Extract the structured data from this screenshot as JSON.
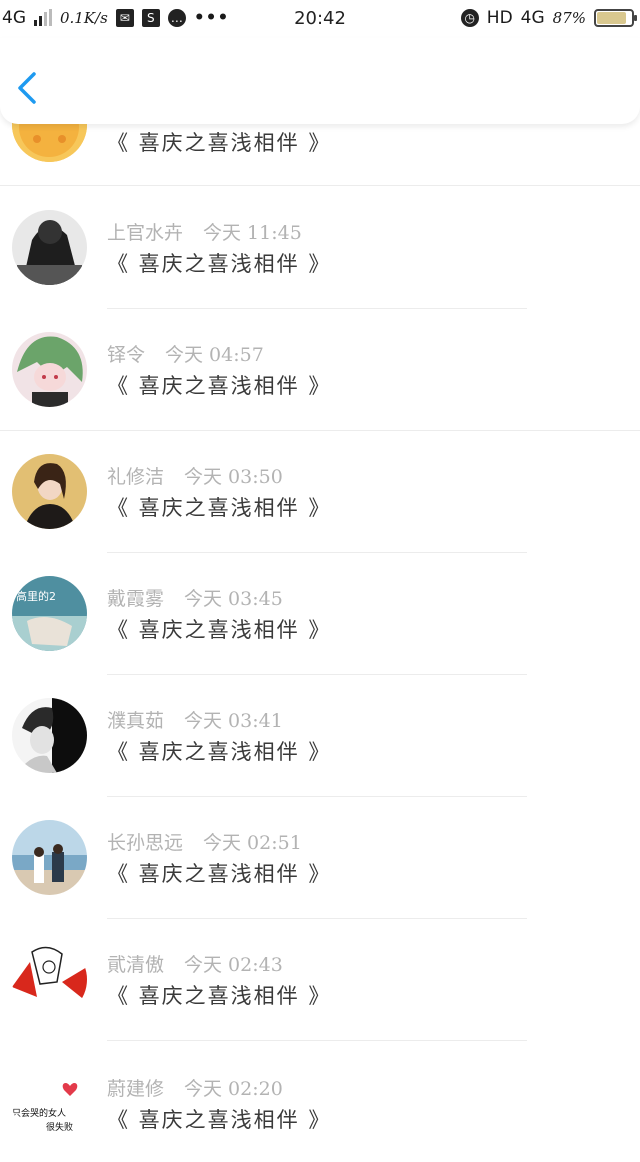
{
  "status_bar": {
    "network": "4G",
    "speed": "0.1K/s",
    "time": "20:42",
    "hd": "HD",
    "network_right": "4G",
    "battery": "87%",
    "battery_level": 0.87
  },
  "navbar": {
    "back_icon": "chevron-left-icon",
    "accent": "#1e9af0"
  },
  "list": [
    {
      "name": "",
      "time": "",
      "message": "《 喜庆之喜浅相伴 》"
    },
    {
      "name": "上官水卉",
      "time": "今天 11:45",
      "message": "《 喜庆之喜浅相伴 》"
    },
    {
      "name": "铎令",
      "time": "今天 04:57",
      "message": "《 喜庆之喜浅相伴 》"
    },
    {
      "name": "礼修洁",
      "time": "今天 03:50",
      "message": "《 喜庆之喜浅相伴 》"
    },
    {
      "name": "戴霞雾",
      "time": "今天 03:45",
      "message": "《 喜庆之喜浅相伴 》"
    },
    {
      "name": "濮真茹",
      "time": "今天 03:41",
      "message": "《 喜庆之喜浅相伴 》"
    },
    {
      "name": "长孙思远",
      "time": "今天 02:51",
      "message": "《 喜庆之喜浅相伴 》"
    },
    {
      "name": "貮清傲",
      "time": "今天 02:43",
      "message": "《 喜庆之喜浅相伴 》"
    },
    {
      "name": "蔚建修",
      "time": "今天 02:20",
      "message": "《 喜庆之喜浅相伴 》"
    }
  ],
  "avatar_texts": {
    "item4": "高里的2",
    "item8_line1": "只会哭的女人",
    "item8_line2": "很失败"
  }
}
